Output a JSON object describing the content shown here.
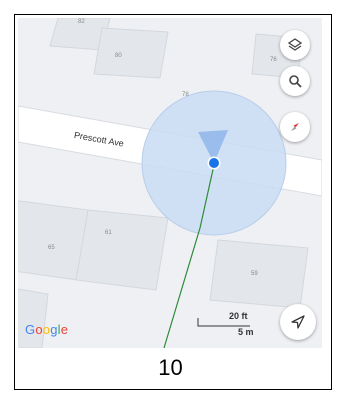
{
  "map": {
    "street_name": "Prescott Ave",
    "building_numbers": [
      "82",
      "80",
      "76",
      "78",
      "61",
      "65",
      "59"
    ],
    "logo_text": "Google",
    "logo_letter_colors": [
      "#4285F4",
      "#EA4335",
      "#FBBC05",
      "#4285F4",
      "#34A853",
      "#EA4335"
    ],
    "scale": {
      "feet": "20 ft",
      "meters": "5 m"
    },
    "buttons": {
      "layers_icon": "layers-icon",
      "search_icon": "search-icon",
      "compass_icon": "compass-icon",
      "navigate_icon": "navigation-arrow-icon"
    },
    "colors": {
      "location_dot": "#1a73e8",
      "accuracy_circle": "#c9dcf3",
      "route_line": "#2e8b3a",
      "compass_needle": "#e53935"
    }
  },
  "caption": "10"
}
